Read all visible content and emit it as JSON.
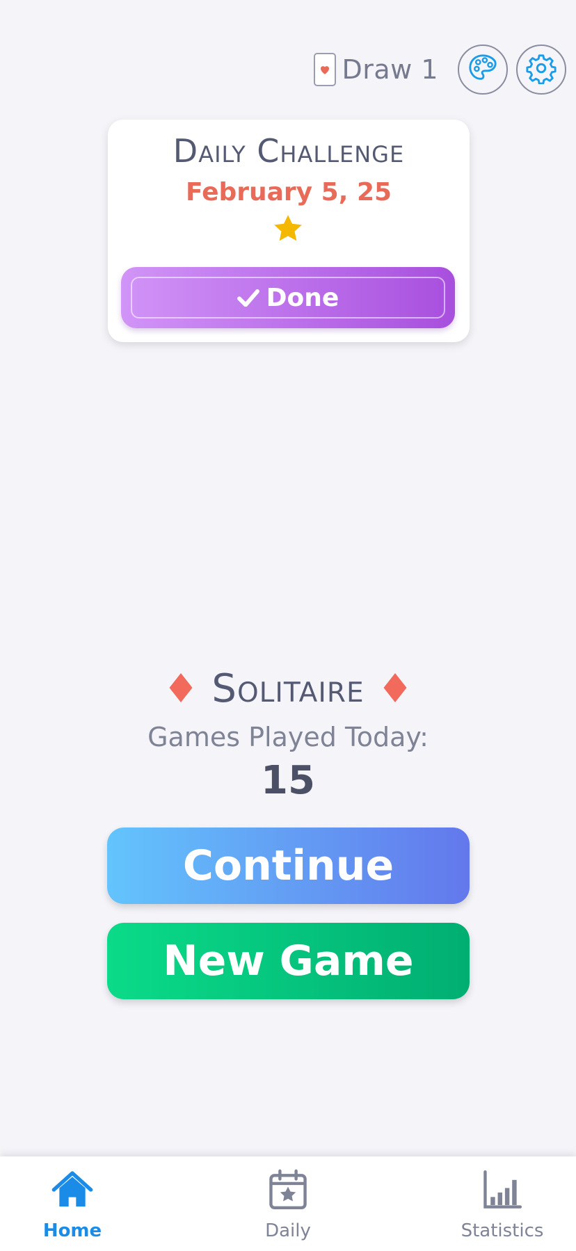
{
  "topbar": {
    "draw_mode_label": "Draw 1",
    "card_icon": "heart-card-icon",
    "theme_icon": "palette-icon",
    "settings_icon": "gear-icon"
  },
  "daily_challenge": {
    "title": "Daily Challenge",
    "date": "February 5, 25",
    "star_icon": "star-icon",
    "button_label": "Done",
    "button_icon": "check-icon"
  },
  "solitaire": {
    "title": "Solitaire",
    "games_played_label": "Games Played Today:",
    "games_played_count": "15",
    "decor_icon": "diamond-icon"
  },
  "buttons": {
    "continue_label": "Continue",
    "new_game_label": "New Game"
  },
  "nav": {
    "items": [
      {
        "label": "Home",
        "icon": "home-icon",
        "active": true
      },
      {
        "label": "Daily",
        "icon": "calendar-star-icon",
        "active": false
      },
      {
        "label": "Statistics",
        "icon": "bar-chart-icon",
        "active": false
      }
    ]
  },
  "colors": {
    "background": "#f4f4f9",
    "accent_red": "#e86b59",
    "done_gradient": [
      "#d194f7",
      "#a84fde"
    ],
    "continue_gradient": [
      "#63c4fc",
      "#6378ec"
    ],
    "new_game_gradient": [
      "#0adb89",
      "#01ae72"
    ],
    "nav_active": "#1a8ce8",
    "star": "#f5b800"
  }
}
